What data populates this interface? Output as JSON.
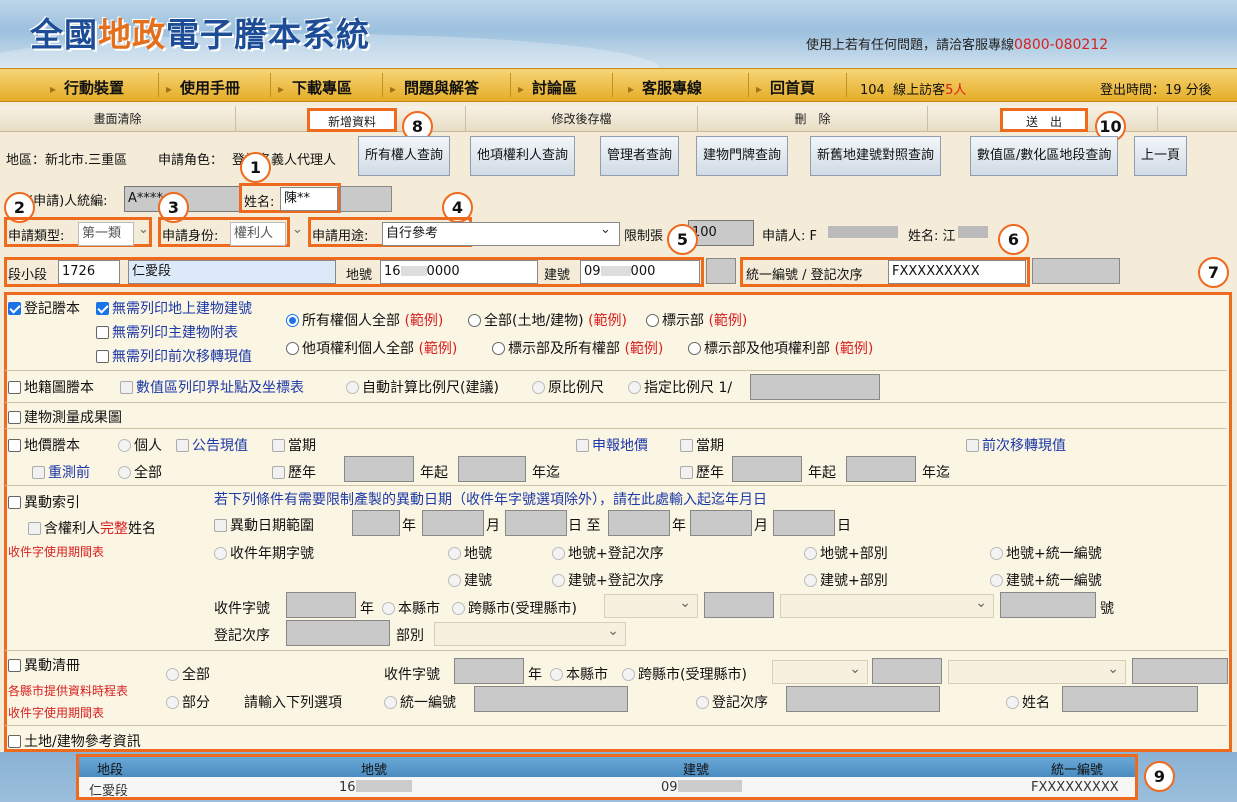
{
  "header": {
    "title_a": "全國",
    "title_b": "地政",
    "title_c": "電子謄本系統",
    "support": "使用上若有任何問題，請洽客服專線",
    "phone": "0800-080212"
  },
  "nav": {
    "items": [
      "行動裝置",
      "使用手冊",
      "下載專區",
      "問題與解答",
      "討論區",
      "客服專線",
      "回首頁"
    ],
    "visitors_count": "104",
    "visitors_label": "線上訪客",
    "visitors_num": "5人",
    "logout": "登出時間：19 分後"
  },
  "actions": {
    "clear": "畫面清除",
    "add": "新增資料",
    "save": "修改後存檔",
    "delete": "刪　除",
    "submit": "送　出"
  },
  "callouts": [
    "1",
    "2",
    "3",
    "4",
    "5",
    "6",
    "7",
    "8",
    "9",
    "10"
  ],
  "applicant": {
    "area": "地區：新北市.三重區",
    "role_label": "申請角色：",
    "role_value": "登記名義人代理人",
    "id_label": "(申請)人統編:",
    "id_value": "A****",
    "name_label": "姓名:",
    "name_value": "陳**"
  },
  "query_buttons": [
    "所有權人查詢",
    "他項權利人查詢",
    "管理者查詢",
    "建物門牌查詢",
    "新舊地建號對照查詢",
    "數值區/數化區地段查詢",
    "上一頁"
  ],
  "row2": {
    "type_label": "申請類型:",
    "type_value": "第一類",
    "identity_label": "申請身份:",
    "identity_value": "權利人",
    "purpose_label": "申請用途:",
    "purpose_value": "自行參考",
    "limit_label": "限制張",
    "limit_value": "100",
    "applicant_label": "申請人: F",
    "name_label": "姓名: 江"
  },
  "row3": {
    "section_label": "段小段",
    "section_code": "1726",
    "section_name": "仁愛段",
    "land_label": "地號",
    "land_value": "16",
    "land_suffix": "0000",
    "bldg_label": "建號",
    "bldg_value": "09",
    "bldg_suffix": "000",
    "uid_label": "統一編號 / 登記次序",
    "uid_value": "FXXXXXXXXX"
  },
  "reg": {
    "title": "登記謄本",
    "opt1": "無需列印地上建物建號",
    "opt2": "無需列印主建物附表",
    "opt3": "無需列印前次移轉現值",
    "r1": "所有權個人全部",
    "r2": "全部(土地/建物)",
    "r3": "標示部",
    "r4": "他項權利個人全部",
    "r5": "標示部及所有權部",
    "r6": "標示部及他項權利部",
    "example": "(範例)"
  },
  "cad": {
    "title": "地籍圖謄本",
    "opt": "數值區列印界址點及坐標表",
    "r1": "自動計算比例尺(建議)",
    "r2": "原比例尺",
    "r3": "指定比例尺 1/"
  },
  "bsurvey": {
    "title": "建物測量成果圖"
  },
  "price": {
    "title": "地價謄本",
    "personal": "個人",
    "announce": "公告現值",
    "current": "當期",
    "declared": "申報地價",
    "current2": "當期",
    "prev": "前次移轉現值",
    "remeasure": "重測前",
    "all": "全部",
    "hist": "歷年",
    "from": "年起",
    "to": "年迄",
    "hist2": "歷年",
    "from2": "年起",
    "to2": "年迄"
  },
  "change": {
    "title": "異動索引",
    "note": "若下列條件有需要限制產製的異動日期（收件年字號選項除外），請在此處輸入起迄年月日",
    "owner_a": "含權利人",
    "owner_b": "完整",
    "owner_c": "姓名",
    "period_link": "收件字使用期間表",
    "date_range": "異動日期範圍",
    "y": "年",
    "m": "月",
    "d": "日 至",
    "y2": "年",
    "m2": "月",
    "d2": "日",
    "recv_year": "收件年期字號",
    "o1": "地號",
    "o2": "地號+登記次序",
    "o3": "地號+部別",
    "o4": "地號+統一編號",
    "o5": "建號",
    "o6": "建號+登記次序",
    "o7": "建號+部別",
    "o8": "建號+統一編號",
    "recv_no": "收件字號",
    "year": "年",
    "this_county": "本縣市",
    "cross": "跨縣市(受理縣市)",
    "hao": "號",
    "reg_seq": "登記次序",
    "part": "部別"
  },
  "list": {
    "title": "異動清冊",
    "all": "全部",
    "part": "部分",
    "county_link": "各縣市提供資料時程表",
    "period_link": "收件字使用期間表",
    "recv_no": "收件字號",
    "year": "年",
    "this_county": "本縣市",
    "cross": "跨縣市(受理縣市)",
    "prompt": "請輸入下列選項",
    "uid": "統一編號",
    "seq": "登記次序",
    "name": "姓名"
  },
  "landref": {
    "title": "土地/建物參考資訊"
  },
  "results": {
    "headers": [
      "地段",
      "地號",
      "建號",
      "統一編號"
    ],
    "row": [
      "仁愛段",
      "16",
      "09",
      "FXXXXXXXXX"
    ]
  }
}
